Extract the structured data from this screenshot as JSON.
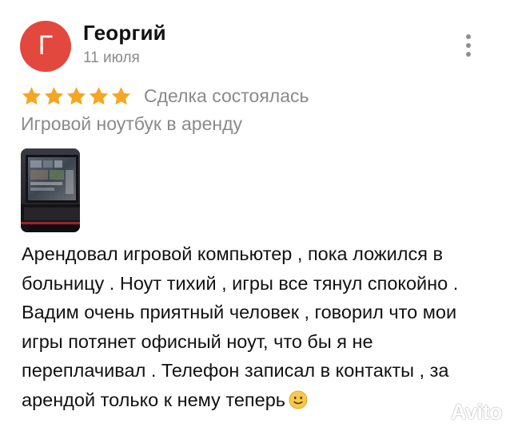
{
  "review": {
    "author": {
      "name": "Георгий",
      "initial": "Г",
      "avatar_color": "#e2483d"
    },
    "date": "11 июля",
    "rating": 5,
    "star_color": "#f5a623",
    "deal_status": "Сделка состоялась",
    "ad_title": "Игровой ноутбук в аренду",
    "text": "Арендовал игровой компьютер , пока ложился в\nбольницу . Ноут тихий , игры все тянул спокойно .\nВадим очень приятный человек , говорил что мои\nигры потянет офисный ноут,  что бы я не\nпереплачивал . Телефон записал в контакты , за\nарендой только к нему теперь",
    "text_emoji": "slightly-smiling-face-icon",
    "photos_count": 1
  },
  "watermark": {
    "label": "Avito"
  },
  "icons": {
    "more": "more-vertical-icon",
    "star": "star-icon",
    "watermark": "avito-logo-icon"
  }
}
